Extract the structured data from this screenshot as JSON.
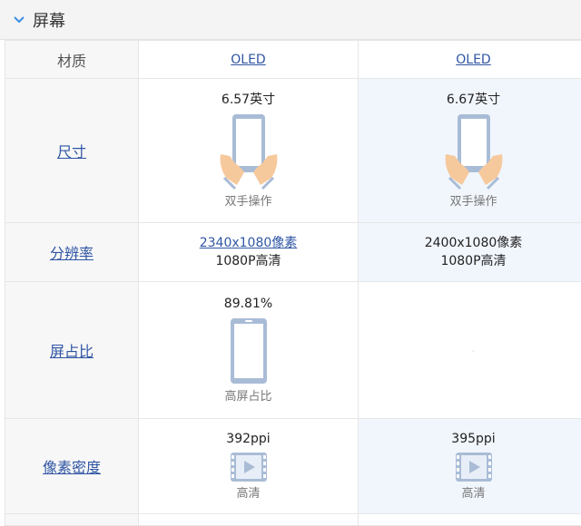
{
  "section": {
    "title": "屏幕",
    "icon": "chevron-down-icon"
  },
  "rows": {
    "material": {
      "label": "材质",
      "c1": "OLED",
      "c2": "OLED"
    },
    "size": {
      "label": "尺寸",
      "c1_value": "6.57英寸",
      "c1_sub": "双手操作",
      "c2_value": "6.67英寸",
      "c2_sub": "双手操作"
    },
    "resolution": {
      "label": "分辨率",
      "c1_value": "2340x1080像素",
      "c1_sub": "1080P高清",
      "c2_value": "2400x1080像素",
      "c2_sub": "1080P高清"
    },
    "ratio": {
      "label": "屏占比",
      "c1_value": "89.81%",
      "c1_sub": "高屏占比",
      "c2_value": "-"
    },
    "density": {
      "label": "像素密度",
      "c1_value": "392ppi",
      "c1_sub": "高清",
      "c2_value": "395ppi",
      "c2_sub": "高清"
    }
  },
  "colors": {
    "link": "#2f55a4",
    "highlight": "#f1f6fd",
    "icon": "#a9bcd6",
    "skin": "#f6c99c"
  }
}
